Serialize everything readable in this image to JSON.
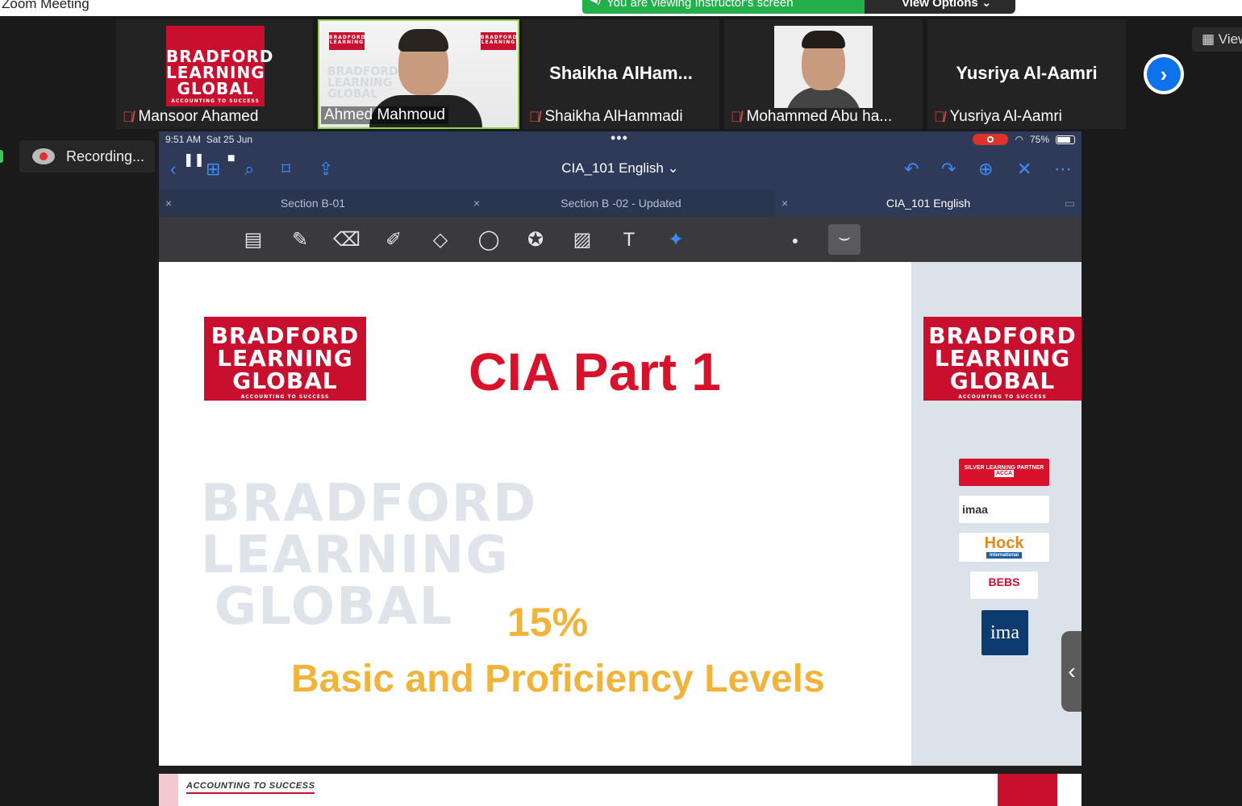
{
  "window": {
    "title": "Zoom Meeting"
  },
  "banner": {
    "text": "You are viewing Instructor's screen",
    "view_options": "View Options"
  },
  "participants": [
    {
      "name": "Mansoor Ahamed",
      "tile_type": "logo",
      "logo_lines": [
        "BRADFORD",
        "LEARNING",
        "GLOBAL"
      ],
      "logo_sub": "ACCOUNTING TO SUCCESS",
      "muted": true
    },
    {
      "name": "Ahmed Mahmoud",
      "tile_type": "video",
      "active": true,
      "muted": false
    },
    {
      "name": "Shaikha AlHammadi",
      "display": "Shaikha  AlHam...",
      "tile_type": "name",
      "muted": true
    },
    {
      "name": "Mohammed Abu ha...",
      "tile_type": "photo",
      "muted": true
    },
    {
      "name": "Yusriya Al-Aamri",
      "display": "Yusriya Al-Aamri",
      "tile_type": "name",
      "muted": true
    }
  ],
  "side_view_label": "View",
  "recording": {
    "label": "Recording..."
  },
  "ipad": {
    "time": "9:51 AM",
    "date": "Sat 25 Jun",
    "battery": "75%",
    "doc_title": "CIA_101 English",
    "tabs": [
      {
        "label": "Section B-01",
        "current": false
      },
      {
        "label": "Section B -02 - Updated",
        "current": false
      },
      {
        "label": "CIA_101 English",
        "current": true
      }
    ]
  },
  "slide": {
    "logo_lines": [
      "BRADFORD",
      "LEARNING",
      "GLOBAL"
    ],
    "logo_sub": "ACCOUNTING TO SUCCESS",
    "title": "CIA Part 1",
    "watermark_lines": [
      "BRADFORD",
      "LEARNING",
      "GLOBAL"
    ],
    "percent": "15%",
    "subtitle": "Basic and Proficiency Levels",
    "footer_tag": "ACCOUNTING TO SUCCESS",
    "partners": [
      {
        "label": "SILVER LEARNING PARTNER",
        "badge": "ACCA"
      },
      {
        "label": "imaa"
      },
      {
        "label": "Hock",
        "sub": "International"
      },
      {
        "label": "BEBS"
      },
      {
        "label": "ima"
      }
    ]
  },
  "colors": {
    "brand_red": "#c8102e",
    "accent_yellow": "#f0b43c",
    "zoom_blue": "#0e72ed",
    "banner_green": "#23b04a"
  }
}
